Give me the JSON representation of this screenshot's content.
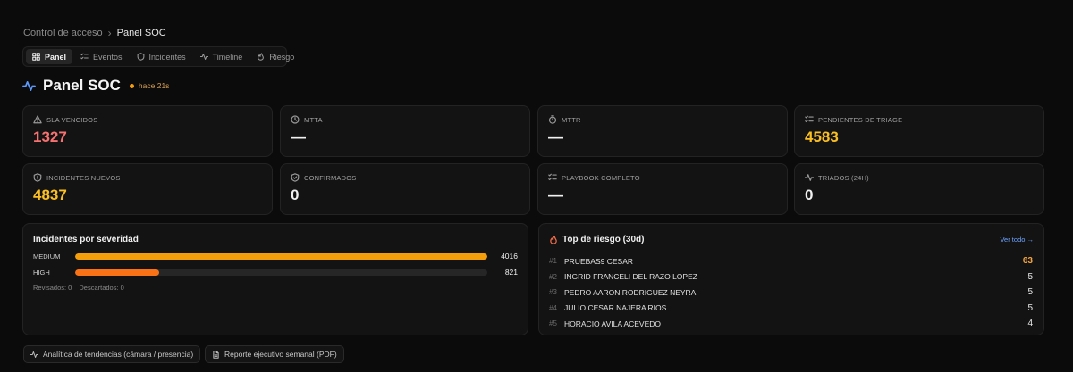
{
  "breadcrumb": {
    "parent": "Control de acceso",
    "separator": "›",
    "current": "Panel SOC"
  },
  "tabs": [
    {
      "label": "Panel",
      "icon": "grid-icon"
    },
    {
      "label": "Eventos",
      "icon": "list-check-icon"
    },
    {
      "label": "Incidentes",
      "icon": "shield-icon"
    },
    {
      "label": "Timeline",
      "icon": "activity-icon"
    },
    {
      "label": "Riesgo",
      "icon": "flame-icon"
    }
  ],
  "header": {
    "title": "Panel SOC",
    "updated": "hace 21s"
  },
  "kpis": [
    {
      "label": "SLA VENCIDOS",
      "value": "1327",
      "color": "#f87171",
      "icon": "warning-icon"
    },
    {
      "label": "MTTA",
      "value": "—",
      "color": "#f1f1f1",
      "icon": "clock-icon"
    },
    {
      "label": "MTTR",
      "value": "—",
      "color": "#f1f1f1",
      "icon": "timer-icon"
    },
    {
      "label": "PENDIENTES DE TRIAGE",
      "value": "4583",
      "color": "#fbbf24",
      "icon": "list-check-icon"
    },
    {
      "label": "INCIDENTES NUEVOS",
      "value": "4837",
      "color": "#fbbf24",
      "icon": "shield-icon"
    },
    {
      "label": "CONFIRMADOS",
      "value": "0",
      "color": "#f1f1f1",
      "icon": "shield-check-icon"
    },
    {
      "label": "PLAYBOOK COMPLETO",
      "value": "—",
      "color": "#f1f1f1",
      "icon": "list-check-icon"
    },
    {
      "label": "TRIADOS (24H)",
      "value": "0",
      "color": "#f1f1f1",
      "icon": "activity-icon"
    }
  ],
  "severity": {
    "title": "Incidentes por severidad",
    "max": 4016,
    "rows": [
      {
        "name": "MEDIUM",
        "value": 4016,
        "color": "#f59e0b"
      },
      {
        "name": "HIGH",
        "value": 821,
        "color": "#f97316"
      }
    ],
    "reviewed": "Revisados: 0",
    "discarded": "Descartados: 0"
  },
  "risk": {
    "title": "Top de riesgo (30d)",
    "see_all": "Ver todo →",
    "items": [
      {
        "rank": "#1",
        "name": "PRUEBAS9 CESAR",
        "score": "63"
      },
      {
        "rank": "#2",
        "name": "INGRID FRANCELI DEL RAZO LOPEZ",
        "score": "5"
      },
      {
        "rank": "#3",
        "name": "PEDRO AARON RODRIGUEZ NEYRA",
        "score": "5"
      },
      {
        "rank": "#4",
        "name": "JULIO CESAR NAJERA RIOS",
        "score": "5"
      },
      {
        "rank": "#5",
        "name": "HORACIO AVILA ACEVEDO",
        "score": "4"
      }
    ]
  },
  "actions": {
    "trends": "Analítica de tendencias (cámara / presencia)",
    "report": "Reporte ejecutivo semanal (PDF)"
  }
}
